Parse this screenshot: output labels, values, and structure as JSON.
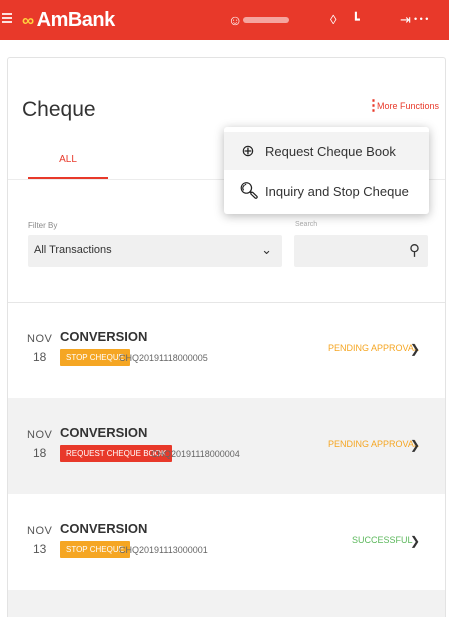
{
  "header": {
    "brand": "AmBank",
    "brand_mark": "∞",
    "user_icon": "user-icon",
    "bar_icons": [
      "notification-icon",
      "mailbox-icon",
      "logout-icon"
    ],
    "bar_icon_glyphs": [
      "◊",
      "┗",
      "⇥"
    ],
    "logout_label": "• • •",
    "accent_color": "#e8392a"
  },
  "page": {
    "title": "Cheque",
    "more_functions": "More Functions"
  },
  "tabs": [
    {
      "label": "ALL",
      "active": true
    }
  ],
  "dropdown": {
    "items": [
      {
        "icon": "plus-circle-icon",
        "glyph": "⊕",
        "label": "Request Cheque Book",
        "highlighted": true
      },
      {
        "icon": "search-icon",
        "glyph": "⌕",
        "label": "Inquiry and Stop Cheque",
        "highlighted": false
      }
    ]
  },
  "filter": {
    "label": "Filter By",
    "value": "All Transactions"
  },
  "search": {
    "label": "Search"
  },
  "transactions": [
    {
      "month": "NOV",
      "day": "18",
      "title": "CONVERSION",
      "badge": "STOP CHEQUE",
      "badge_color": "#f5a623",
      "ref": "CHQ20191118000005",
      "status": "PENDING APPROVAL",
      "status_color": "#f5a623"
    },
    {
      "month": "NOV",
      "day": "18",
      "title": "CONVERSION",
      "badge": "REQUEST CHEQUE BOOK",
      "badge_color": "#e8392a",
      "ref": "CHQ20191118000004",
      "status": "PENDING APPROVAL",
      "status_color": "#f5a623"
    },
    {
      "month": "NOV",
      "day": "13",
      "title": "CONVERSION",
      "badge": "STOP CHEQUE",
      "badge_color": "#f5a623",
      "ref": "CHQ20191113000001",
      "status": "SUCCESSFUL",
      "status_color": "#5cb85c"
    }
  ]
}
